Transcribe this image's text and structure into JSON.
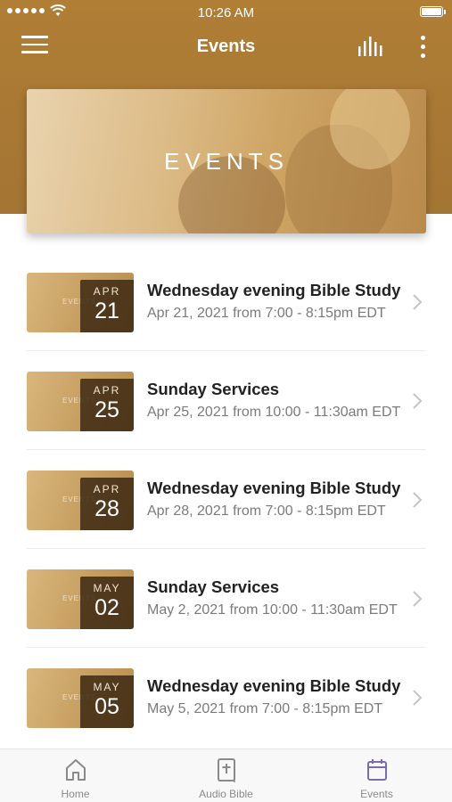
{
  "status_bar": {
    "time": "10:26 AM"
  },
  "nav": {
    "title": "Events"
  },
  "banner": {
    "label": "EVENTS"
  },
  "events": [
    {
      "month": "APR",
      "day": "21",
      "title": "Wednesday evening Bible Study",
      "subtitle": "Apr 21, 2021 from 7:00 - 8:15pm EDT",
      "thumb_text": "EVENTS"
    },
    {
      "month": "APR",
      "day": "25",
      "title": "Sunday Services",
      "subtitle": "Apr 25, 2021 from 10:00 - 11:30am EDT",
      "thumb_text": "EVENTS"
    },
    {
      "month": "APR",
      "day": "28",
      "title": "Wednesday evening Bible Study",
      "subtitle": "Apr 28, 2021 from 7:00 - 8:15pm EDT",
      "thumb_text": "EVENTS"
    },
    {
      "month": "MAY",
      "day": "02",
      "title": "Sunday Services",
      "subtitle": "May 2, 2021 from 10:00 - 11:30am EDT",
      "thumb_text": "EVENTS"
    },
    {
      "month": "MAY",
      "day": "05",
      "title": "Wednesday evening Bible Study",
      "subtitle": "May 5, 2021 from 7:00 - 8:15pm EDT",
      "thumb_text": "EVENTS"
    }
  ],
  "tabs": [
    {
      "label": "Home",
      "icon": "home-icon"
    },
    {
      "label": "Audio Bible",
      "icon": "bible-icon"
    },
    {
      "label": "Events",
      "icon": "calendar-icon"
    }
  ],
  "colors": {
    "header": "#a87834",
    "tab_active": "#7d6bb0"
  }
}
